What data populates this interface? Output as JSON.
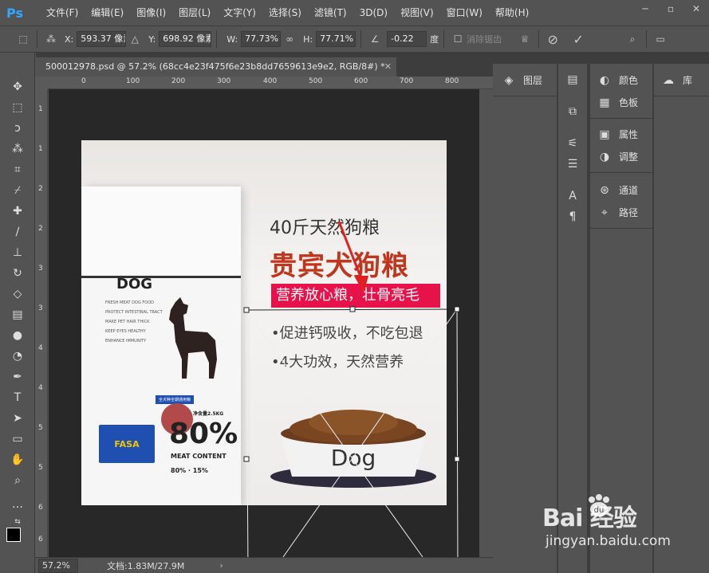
{
  "app": {
    "logo": "Ps",
    "menu": [
      "文件(F)",
      "编辑(E)",
      "图像(I)",
      "图层(L)",
      "文字(Y)",
      "选择(S)",
      "滤镜(T)",
      "3D(D)",
      "视图(V)",
      "窗口(W)",
      "帮助(H)"
    ],
    "window_controls": [
      "minimize-icon",
      "restore-icon",
      "close-icon"
    ]
  },
  "options_bar": {
    "x_label": "X:",
    "x_value": "593.37 像素",
    "y_label": "Y:",
    "y_value": "698.92 像素",
    "w_label": "W:",
    "w_value": "77.73%",
    "h_label": "H:",
    "h_value": "77.71%",
    "angle_value": "-0.22",
    "angle_unit": "度",
    "antialias_label": "消除锯齿"
  },
  "document": {
    "tab_title": "500012978.psd @ 57.2% (68cc4e23f475f6e23b8dd7659613e9e2, RGB/8#) *",
    "ruler_top": [
      "0",
      "100",
      "200",
      "300",
      "400",
      "500",
      "600",
      "700",
      "800"
    ],
    "ruler_left": [
      "1",
      "1",
      "2",
      "2",
      "3",
      "3",
      "4",
      "4",
      "5",
      "5",
      "6",
      "6"
    ]
  },
  "artwork": {
    "headline_small": "40斤天然狗粮",
    "headline_big": "贵宾犬狗粮",
    "band_text": "营养放心粮，壮骨亮毛",
    "bullet_1": "•促进钙吸收，不吃包退",
    "bullet_2": "•4大功效，天然营养",
    "bag_title": "DOG",
    "bag_percent": "80%",
    "bag_meat": "MEAT CONTENT",
    "bag_brand": "FASA",
    "bag_weight": "净含量2.5KG",
    "bag_bottom": "80% · 15%",
    "bag_label": "全犬种全期通用粮",
    "bag_lines": [
      "FRESH MEAT DOG FOOD",
      "PROTECT INTESTINAL TRACT",
      "MAKE PET HAIR THICK",
      "KEEP EYES HEALTHY",
      "ENHANCE IMMUNITY"
    ],
    "bowl_text": "Dog"
  },
  "panels": {
    "col1": [
      {
        "icon": "layers-icon",
        "label": "图层"
      }
    ],
    "col3": [
      {
        "icon": "palette-icon",
        "label": "颜色"
      },
      {
        "icon": "grid-icon",
        "label": "色板"
      },
      {
        "icon": "properties-icon",
        "label": "属性"
      },
      {
        "icon": "adjust-icon",
        "label": "调整"
      },
      {
        "icon": "channels-icon",
        "label": "通道"
      },
      {
        "icon": "paths-icon",
        "label": "路径"
      }
    ],
    "col4": [
      {
        "icon": "cloud-icon",
        "label": "库"
      }
    ]
  },
  "status": {
    "zoom": "57.2%",
    "doc_info": "文档:1.83M/27.9M"
  },
  "watermark": {
    "main": "Bai  经验",
    "du": "du",
    "sub": "jingyan.baidu.com"
  }
}
